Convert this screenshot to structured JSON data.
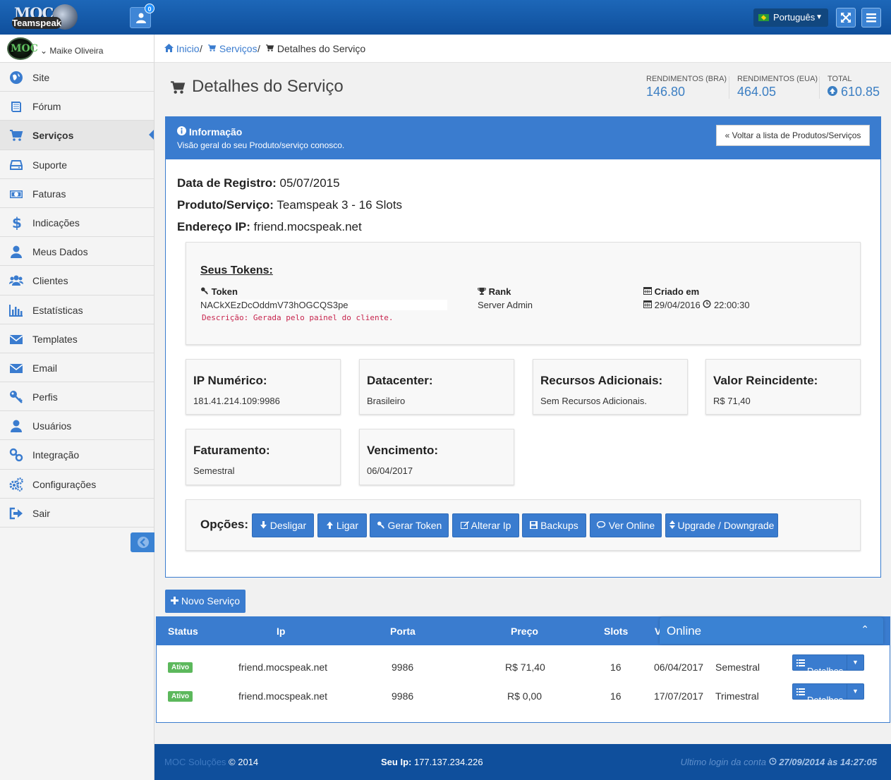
{
  "topbar": {
    "logo_top": "MOC",
    "logo_bottom": "Teamspeak",
    "notifications_count": "0",
    "language": "Português"
  },
  "sidebar": {
    "user_name": "Maike Oliveira",
    "avatar_text": "MOC",
    "items": [
      {
        "label": "Site",
        "icon": "globe-icon"
      },
      {
        "label": "Fórum",
        "icon": "book-icon"
      },
      {
        "label": "Serviços",
        "icon": "cart-icon",
        "active": true
      },
      {
        "label": "Suporte",
        "icon": "hdd-icon"
      },
      {
        "label": "Faturas",
        "icon": "money-icon"
      },
      {
        "label": "Indicações",
        "icon": "dollar-icon"
      },
      {
        "label": "Meus Dados",
        "icon": "user-icon"
      },
      {
        "label": "Clientes",
        "icon": "users-icon"
      },
      {
        "label": "Estatísticas",
        "icon": "bar-chart-icon"
      },
      {
        "label": "Templates",
        "icon": "envelope-icon"
      },
      {
        "label": "Email",
        "icon": "envelope-icon"
      },
      {
        "label": "Perfis",
        "icon": "key-icon"
      },
      {
        "label": "Usuários",
        "icon": "user-icon"
      },
      {
        "label": "Integração",
        "icon": "link-icon"
      },
      {
        "label": "Configurações",
        "icon": "cogs-icon"
      },
      {
        "label": "Sair",
        "icon": "sign-out-icon"
      }
    ]
  },
  "breadcrumb": {
    "home": "Inicio",
    "services": "Serviços",
    "current": "Detalhes do Serviço",
    "sep": "/"
  },
  "page": {
    "title": "Detalhes do Serviço"
  },
  "stats": [
    {
      "label": "RENDIMENTOS (BRA)",
      "value": "146.80"
    },
    {
      "label": "RENDIMENTOS (EUA)",
      "value": "464.05"
    },
    {
      "label": "TOTAL",
      "value": "610.85"
    }
  ],
  "panel": {
    "title": "Informação",
    "subtitle": "Visão geral do seu Produto/serviço conosco.",
    "back_button": "« Voltar a lista de Produtos/Serviços",
    "registro_label": "Data de Registro:",
    "registro_value": "05/07/2015",
    "produto_label": "Produto/Serviço:",
    "produto_value": "Teamspeak 3 - 16 Slots",
    "ip_label": "Endereço IP:",
    "ip_value": "friend.mocspeak.net"
  },
  "tokens": {
    "title": "Seus Tokens:",
    "token_header": "Token",
    "token_value": "NACkXEzDcOddmV73hOGCQS3pe",
    "rank_header": "Rank",
    "rank_value": "Server Admin",
    "criado_header": "Criado em",
    "criado_date": "29/04/2016",
    "criado_time": "22:00:30",
    "descricao": "Descrição: Gerada pelo painel do cliente."
  },
  "cards": [
    {
      "title": "IP Numérico:",
      "value": "181.41.214.109:9986"
    },
    {
      "title": "Datacenter:",
      "value": "Brasileiro"
    },
    {
      "title": "Recursos Adicionais:",
      "value": "Sem Recursos Adicionais."
    },
    {
      "title": "Valor Reincidente:",
      "value": "R$ 71,40"
    },
    {
      "title": "Faturamento:",
      "value": "Semestral"
    },
    {
      "title": "Vencimento:",
      "value": "06/04/2017"
    }
  ],
  "options": {
    "label": "Opções:",
    "buttons": [
      "Desligar",
      "Ligar",
      "Gerar Token",
      "Alterar Ip",
      "Backups",
      "Ver Online",
      "Upgrade / Downgrade"
    ]
  },
  "novo_servico": "Novo Serviço",
  "table": {
    "headers": [
      "Status",
      "Ip",
      "Porta",
      "Preço",
      "Slots",
      "V"
    ],
    "rows": [
      {
        "status": "Ativo",
        "ip": "friend.mocspeak.net",
        "porta": "9986",
        "preco": "R$ 71,40",
        "slots": "16",
        "vencimento": "06/04/2017",
        "ciclo": "Semestral",
        "action": "Detalhes"
      },
      {
        "status": "Ativo",
        "ip": "friend.mocspeak.net",
        "porta": "9986",
        "preco": "R$ 0,00",
        "slots": "16",
        "vencimento": "17/07/2017",
        "ciclo": "Trimestral",
        "action": "Detalhes"
      }
    ]
  },
  "online_widget": {
    "title": "Online"
  },
  "footer": {
    "brand": "MOC Soluções",
    "copyright": "© 2014",
    "ip_label": "Seu Ip:",
    "ip_value": "177.137.234.226",
    "last_login_label": "Ultimo login da conta",
    "last_login_value": "27/09/2014 às 14:27:05"
  },
  "colors": {
    "primary": "#3a7ccf",
    "topbar": "#1d67b8",
    "footer": "#0f4f9c",
    "status_active": "#5cb85c"
  }
}
